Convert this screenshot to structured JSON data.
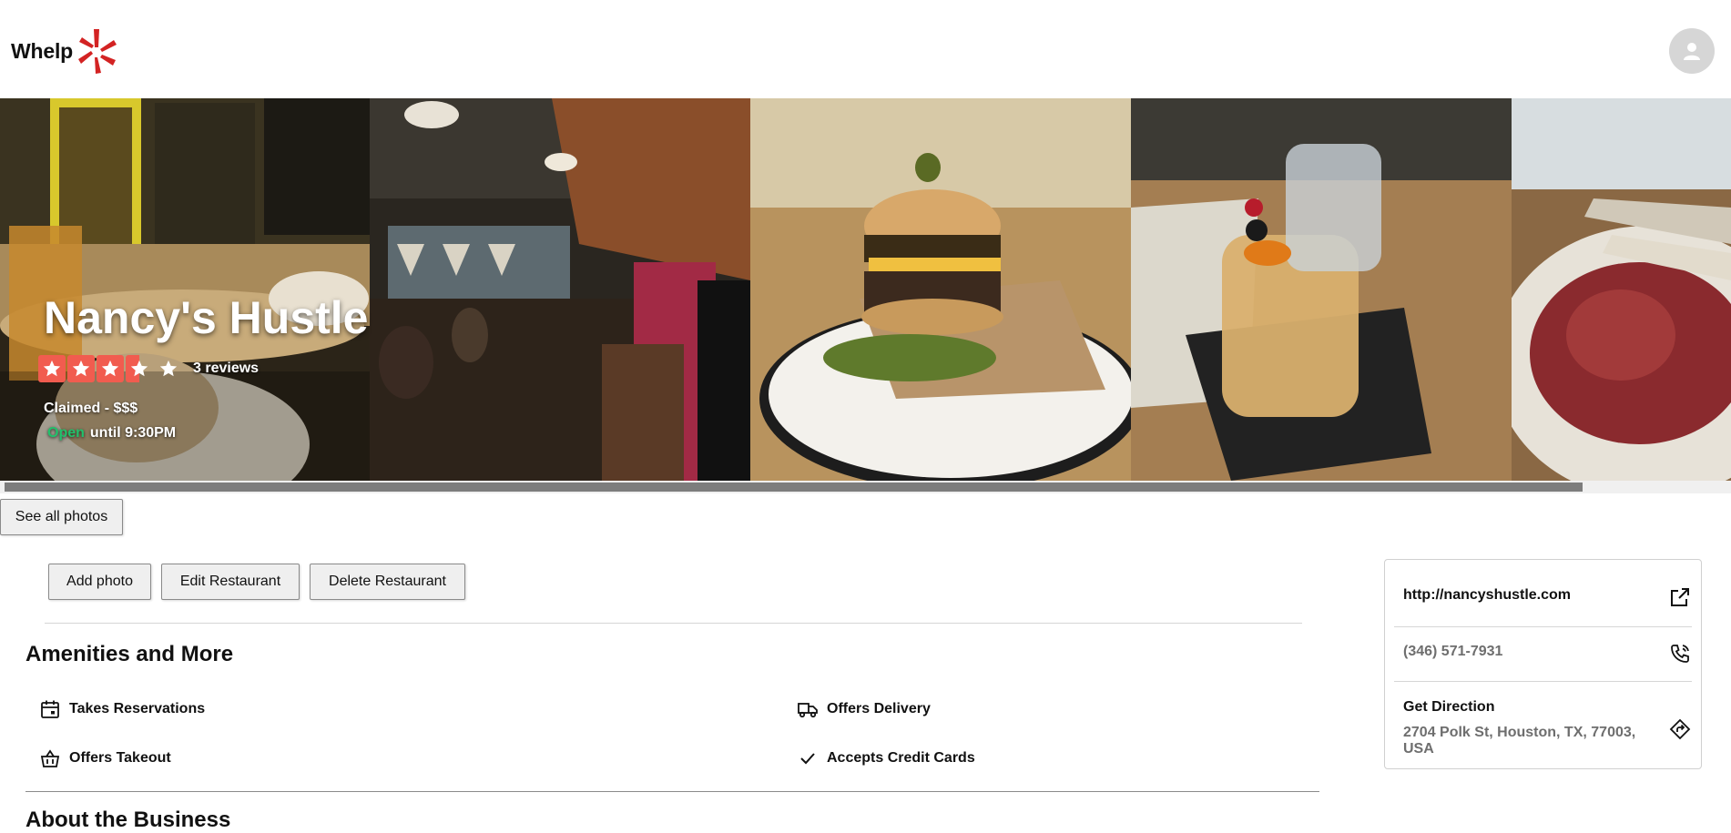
{
  "app": {
    "logo_text": "Whelp"
  },
  "business": {
    "name": "Nancy's Hustle",
    "rating": 3.5,
    "reviews_text": "3 reviews",
    "claimed_text": "Claimed - $$$",
    "open_status": "Open",
    "hours_text": "until 9:30PM"
  },
  "gallery": {
    "photos": [
      "photo-bar-interior",
      "photo-restaurant-interior",
      "photo-burger",
      "photo-cocktail",
      "photo-dish"
    ],
    "see_all_label": "See all photos"
  },
  "actions": {
    "add_photo": "Add photo",
    "edit_restaurant": "Edit Restaurant",
    "delete_restaurant": "Delete Restaurant"
  },
  "amenities": {
    "title": "Amenities and More",
    "items": [
      {
        "label": "Takes Reservations",
        "icon": "calendar-icon"
      },
      {
        "label": "Offers Delivery",
        "icon": "delivery-truck-icon"
      },
      {
        "label": "Offers Takeout",
        "icon": "basket-icon"
      },
      {
        "label": "Accepts Credit Cards",
        "icon": "checkmark-icon"
      }
    ]
  },
  "about": {
    "title": "About the Business"
  },
  "sidebar": {
    "website": "http://nancyshustle.com",
    "phone": "(346) 571-7931",
    "directions_title": "Get Direction",
    "address": "2704 Polk St, Houston, TX, 77003, USA"
  },
  "colors": {
    "brand_red": "#d32323",
    "star_red": "#f15c4f",
    "open_green": "#21c16b"
  }
}
